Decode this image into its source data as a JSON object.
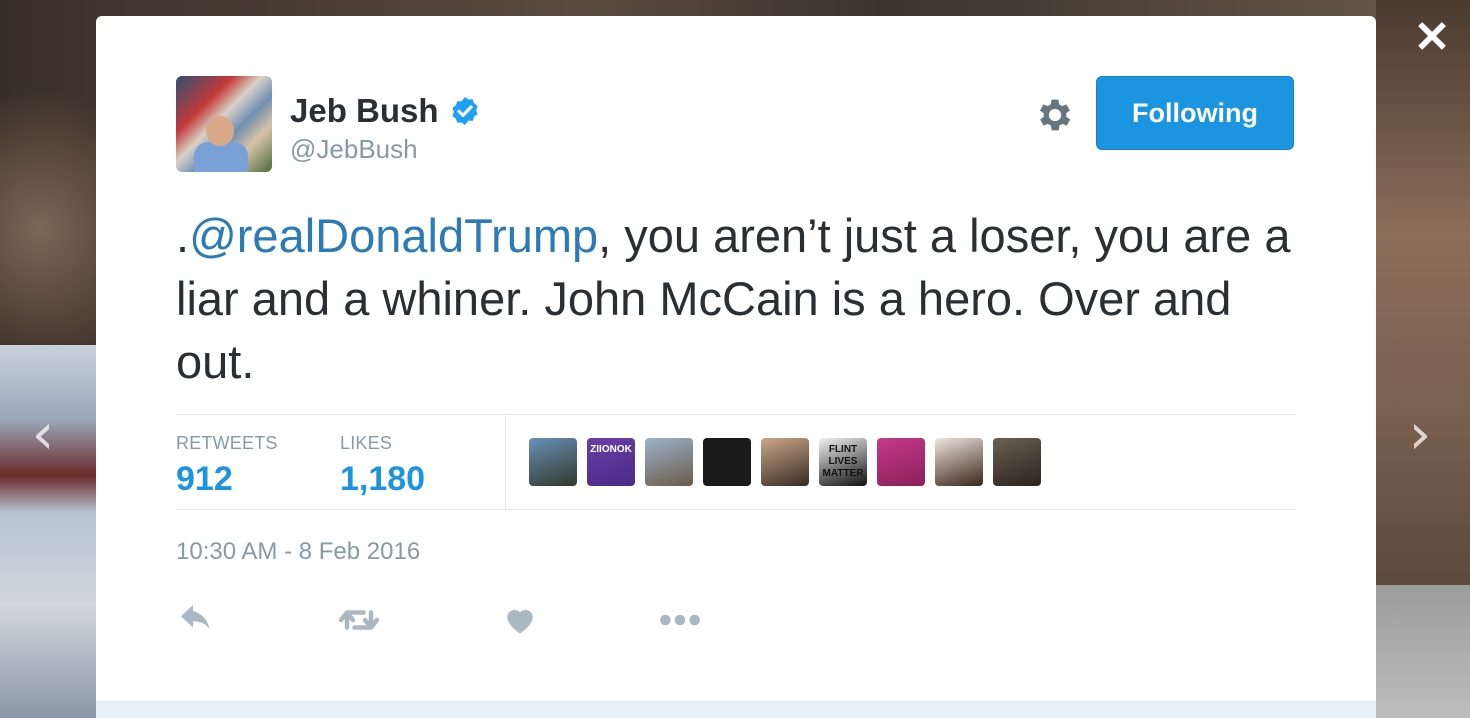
{
  "overlay": {
    "close_icon": "close-icon",
    "prev_icon": "chevron-left-icon",
    "next_icon": "chevron-right-icon",
    "close_glyph": "✕",
    "prev_glyph": "‹",
    "next_glyph": "›"
  },
  "author": {
    "name": "Jeb Bush",
    "handle": "@JebBush",
    "verified": true,
    "verified_color": "#1da1f2"
  },
  "header": {
    "settings_icon": "gear-icon",
    "follow_label": "Following",
    "follow_color": "#1b95e0"
  },
  "tweet": {
    "prefix": ".",
    "mention": "@realDonaldTrump",
    "body": ", you aren’t just a loser, you are a liar and a whiner. John McCain is a hero. Over and out.",
    "mention_color": "#2b7bb9"
  },
  "stats": {
    "retweets_label": "RETWEETS",
    "retweets_value": "912",
    "likes_label": "LIKES",
    "likes_value": "1,180",
    "value_color": "#1b95e0"
  },
  "likers": [
    {
      "name": "liker-avatar-1",
      "colors": [
        "#6b8fb8",
        "#2e3a2a"
      ],
      "text": ""
    },
    {
      "name": "liker-avatar-2",
      "colors": [
        "#6a3fa8",
        "#4b2a86"
      ],
      "text": "ZIIONOK"
    },
    {
      "name": "liker-avatar-3",
      "colors": [
        "#9bb3cc",
        "#6b5a48"
      ],
      "text": ""
    },
    {
      "name": "liker-avatar-4",
      "colors": [
        "#1a1a1a",
        "#1a1a1a"
      ],
      "text": ""
    },
    {
      "name": "liker-avatar-5",
      "colors": [
        "#caa78a",
        "#3a2a22"
      ],
      "text": ""
    },
    {
      "name": "liker-avatar-6",
      "colors": [
        "#f2f2f2",
        "#111111"
      ],
      "text": "FLINT LIVES MATTER"
    },
    {
      "name": "liker-avatar-7",
      "colors": [
        "#c43a8a",
        "#8a1f5a"
      ],
      "text": ""
    },
    {
      "name": "liker-avatar-8",
      "colors": [
        "#f0e6e0",
        "#3a2418"
      ],
      "text": ""
    },
    {
      "name": "liker-avatar-9",
      "colors": [
        "#6a5f52",
        "#2a241e"
      ],
      "text": ""
    }
  ],
  "timestamp": "10:30 AM - 8 Feb 2016",
  "actions": {
    "reply_icon": "reply-icon",
    "retweet_icon": "retweet-icon",
    "like_icon": "heart-icon",
    "more_icon": "more-icon",
    "icon_color": "#aab8c2"
  }
}
